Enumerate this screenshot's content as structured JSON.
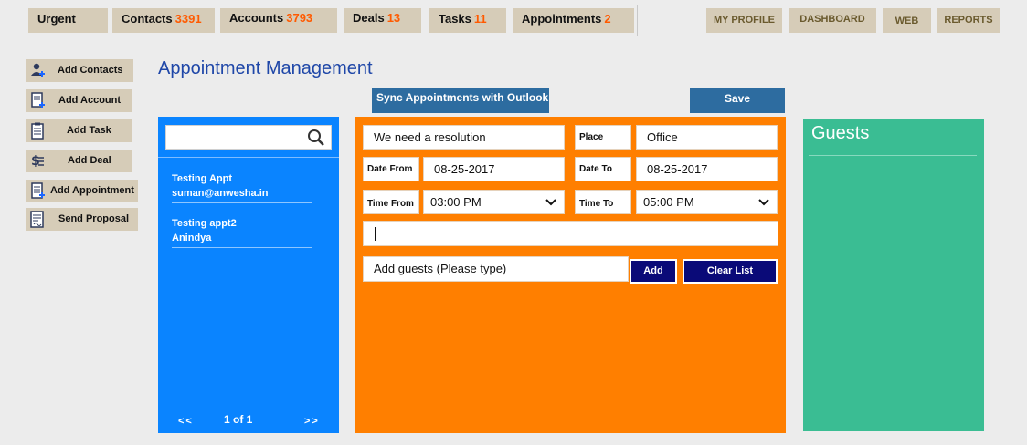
{
  "top_nav": {
    "tabs": [
      {
        "label": "Urgent",
        "count": ""
      },
      {
        "label": "Contacts",
        "count": "3391"
      },
      {
        "label": "Accounts",
        "count": "3793"
      },
      {
        "label": "Deals",
        "count": "13"
      },
      {
        "label": "Tasks",
        "count": "11"
      },
      {
        "label": "Appointments",
        "count": "2"
      }
    ],
    "right_buttons": [
      "MY PROFILE",
      "DASHBOARD",
      "WEB",
      "REPORTS"
    ]
  },
  "sidebar": {
    "actions": [
      {
        "label": "Add Contacts",
        "icon": "add-contact-icon"
      },
      {
        "label": "Add Account",
        "icon": "add-account-icon"
      },
      {
        "label": "Add Task",
        "icon": "add-task-icon"
      },
      {
        "label": "Add Deal",
        "icon": "add-deal-icon"
      },
      {
        "label": "Add Appointment",
        "icon": "add-appointment-icon"
      },
      {
        "label": "Send Proposal",
        "icon": "proposal-icon"
      }
    ]
  },
  "page": {
    "title": "Appointment Management",
    "sync_label": "Sync Appointments with Outlook",
    "save_label": "Save"
  },
  "list_panel": {
    "search_value": "",
    "items": [
      {
        "title": "Testing Appt",
        "subtitle": "suman@anwesha.in"
      },
      {
        "title": "Testing appt2",
        "subtitle": "Anindya"
      }
    ],
    "prev_label": "<<",
    "page_text": "1 of 1",
    "next_label": ">>"
  },
  "form": {
    "subject_value": "We need a resolution",
    "place_label": "Place",
    "place_value": "Office",
    "date_from_label": "Date From",
    "date_from_value": "08-25-2017",
    "date_to_label": "Date To",
    "date_to_value": "08-25-2017",
    "time_from_label": "Time From",
    "time_from_value": "03:00 PM",
    "time_to_label": "Time To",
    "time_to_value": "05:00 PM",
    "description_value": "",
    "guests_placeholder": "Add guests (Please type)",
    "add_label": "Add",
    "clear_label": "Clear List"
  },
  "guests_panel": {
    "title": "Guests"
  },
  "colors": {
    "accent_blue": "#0a84ff",
    "form_orange": "#ff7f00",
    "guests_green": "#3abd93",
    "count_orange": "#ff5a00",
    "button_navy": "#0a0a78",
    "title_blue": "#1f47a8"
  }
}
